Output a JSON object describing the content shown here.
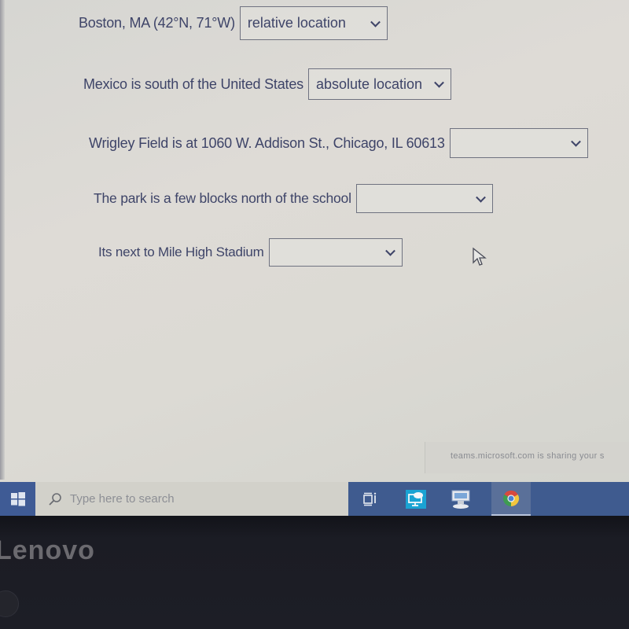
{
  "questions": [
    {
      "prompt": "Boston, MA (42°N, 71°W)",
      "selected": "relative location"
    },
    {
      "prompt": "Mexico is south of the United States",
      "selected": "absolute location"
    },
    {
      "prompt": "Wrigley Field is at 1060 W. Addison St., Chicago, IL 60613",
      "selected": ""
    },
    {
      "prompt": "The park is a few blocks north of the school",
      "selected": ""
    },
    {
      "prompt": "Its next to Mile High Stadium",
      "selected": ""
    }
  ],
  "share_banner": "teams.microsoft.com is sharing your s",
  "taskbar": {
    "search_placeholder": "Type here to search",
    "icons": [
      "task-view-icon",
      "remote-desktop-icon",
      "computer-icon",
      "chrome-icon"
    ],
    "colors": {
      "taskbar": "#3f5b8f",
      "start": "#3f5b95"
    }
  },
  "bezel": {
    "brand": "Lenovo"
  },
  "colors": {
    "text": "#3e4468",
    "background": "#d8d7d2"
  }
}
